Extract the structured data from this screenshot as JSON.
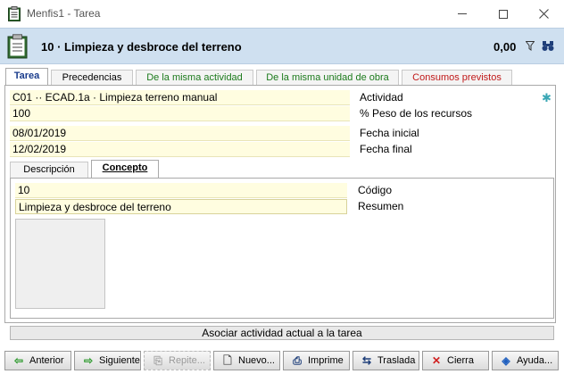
{
  "window": {
    "title": "Menfis1 - Tarea"
  },
  "header": {
    "title": "10 · Limpieza y desbroce del terreno",
    "amount": "0,00"
  },
  "tabs": [
    {
      "label": "Tarea",
      "color": "#1a3c8c",
      "active": true
    },
    {
      "label": "Precedencias",
      "color": "#000000"
    },
    {
      "label": "De la misma actividad",
      "color": "#1b7a1b"
    },
    {
      "label": "De la misma unidad de obra",
      "color": "#1b7a1b"
    },
    {
      "label": "Consumos previstos",
      "color": "#c01818"
    }
  ],
  "fields": {
    "actividad": {
      "value": "C01 ·· ECAD.1a · Limpieza terreno manual",
      "label": "Actividad"
    },
    "peso": {
      "value": "100",
      "label": "% Peso de los recursos"
    },
    "fecha_inicial": {
      "value": "08/01/2019",
      "label": "Fecha inicial"
    },
    "fecha_final": {
      "value": "12/02/2019",
      "label": "Fecha final"
    }
  },
  "inner_tabs": [
    {
      "label": "Descripción",
      "active": false
    },
    {
      "label": "Concepto",
      "active": true
    }
  ],
  "concepto": {
    "codigo": {
      "value": "10",
      "label": "Código"
    },
    "resumen": {
      "value": "Limpieza y desbroce del terreno",
      "label": "Resumen"
    }
  },
  "associate_label": "Asociar actividad actual a la tarea",
  "toolbar": {
    "anterior": "Anterior",
    "siguiente": "Siguiente",
    "repite": "Repite...",
    "nuevo": "Nuevo...",
    "imprime": "Imprime",
    "traslada": "Traslada",
    "cierra": "Cierra",
    "ayuda": "Ayuda..."
  },
  "colors": {
    "header_bg": "#cfe0f0",
    "field_bg": "#fffde0",
    "accent_green": "#2e9a2e",
    "close_red": "#d02020"
  }
}
